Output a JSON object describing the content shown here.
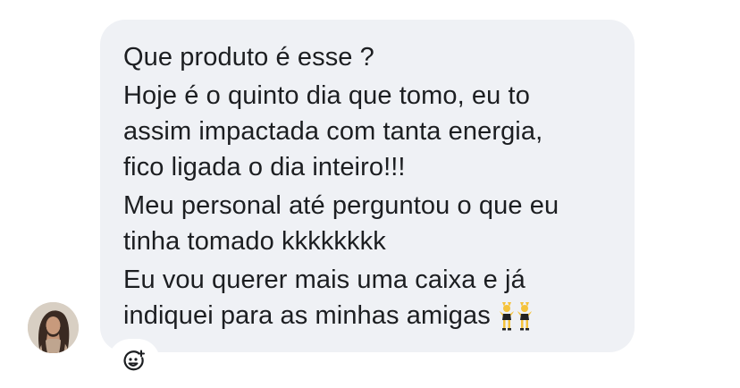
{
  "message": {
    "paragraphs": [
      {
        "lines": [
          "Que produto é esse ?"
        ]
      },
      {
        "lines": [
          "Hoje é o quinto dia que tomo, eu to",
          "assim impactada com tanta energia,",
          "fico ligada o dia inteiro!!!"
        ]
      },
      {
        "lines": [
          "Meu personal até perguntou o que eu",
          "tinha tomado kkkkkkkk"
        ]
      },
      {
        "lines": [
          "Eu vou querer mais uma caixa e já",
          "indiquei para as minhas amigas"
        ]
      }
    ],
    "trailing_icon": "dancing-women-icon"
  },
  "sender": {
    "avatar_icon": "user-avatar"
  },
  "actions": {
    "react_icon": "add-reaction-icon"
  },
  "colors": {
    "bubble_bg": "#eff1f5",
    "text": "#1c1e21",
    "icon": "#1c1e21",
    "emoji_skin": "#f5c33b",
    "emoji_outfit": "#222222"
  }
}
